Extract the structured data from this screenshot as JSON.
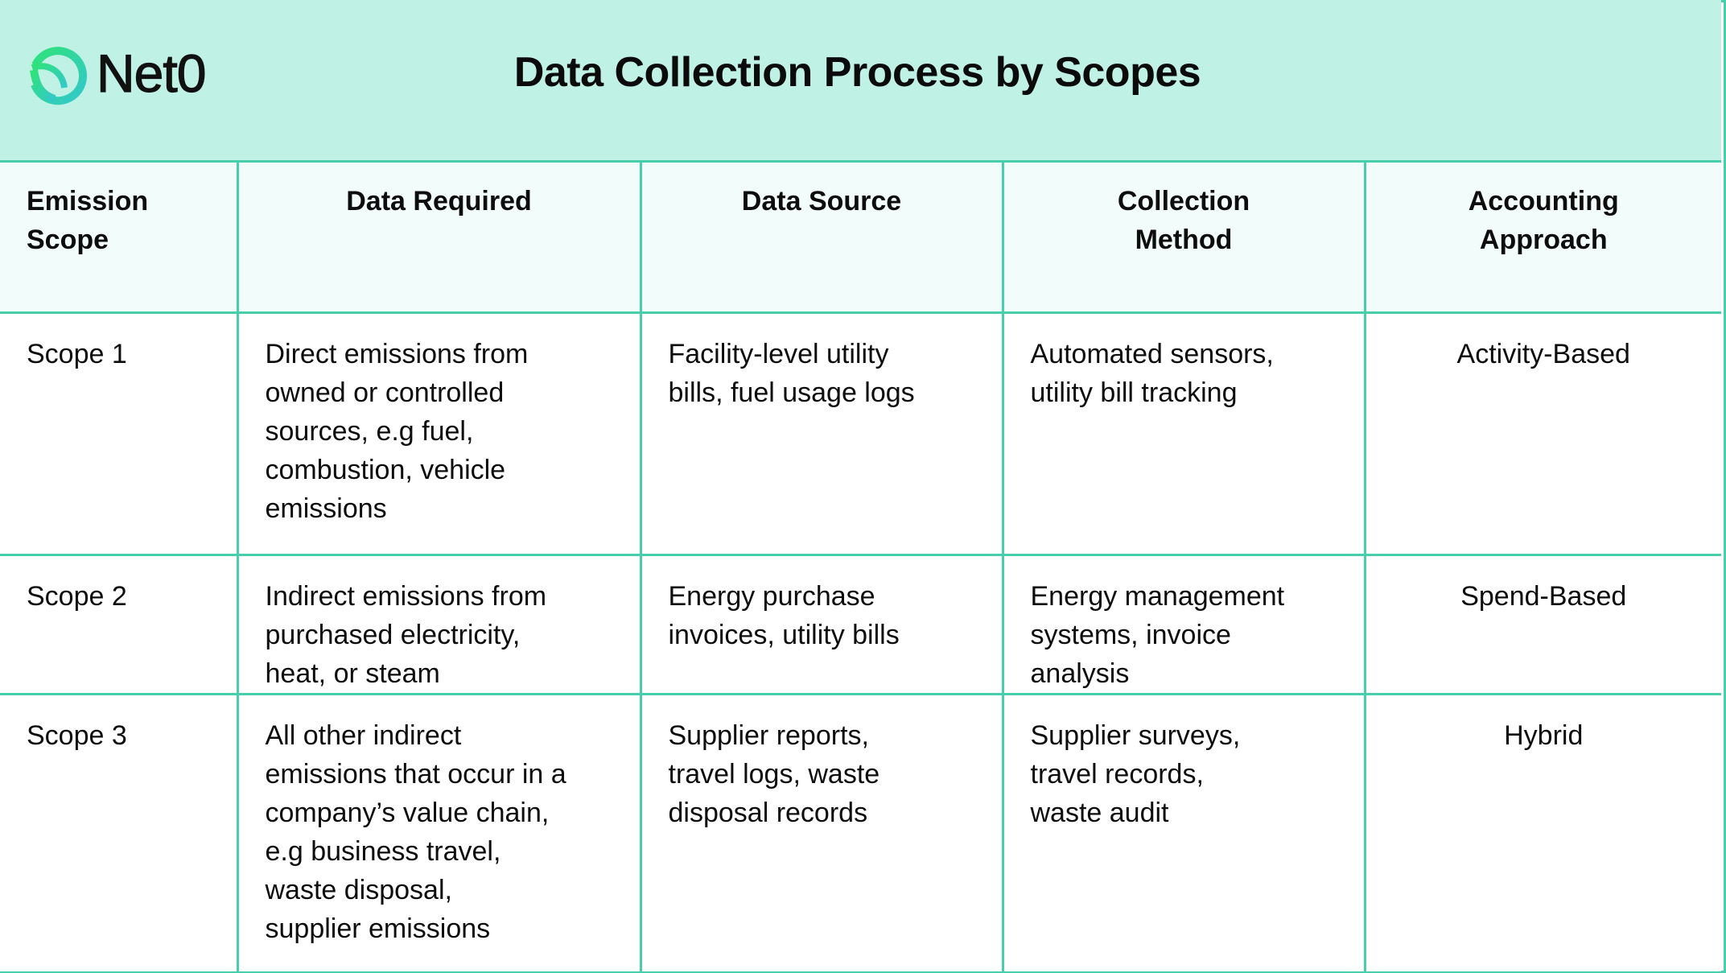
{
  "header": {
    "brand_name": "Net0",
    "logo_icon": "leaf-ring-icon",
    "title": "Data Collection Process by Scopes"
  },
  "colors": {
    "accent_border": "#47cfac",
    "banner_bg": "#c0f1e5",
    "header_row_bg": "#f2fcfa",
    "logo_gradient_start": "#2fe27a",
    "logo_gradient_end": "#33c8cc"
  },
  "table": {
    "columns": [
      "Emission\nScope",
      "Data Required",
      "Data Source",
      "Collection\nMethod",
      "Accounting\nApproach"
    ],
    "rows": [
      {
        "scope": "Scope 1",
        "data_required": "Direct emissions from\nowned or controlled\nsources, e.g fuel,\ncombustion, vehicle\nemissions",
        "data_source": "Facility-level utility\nbills, fuel usage logs",
        "collection_method": "Automated sensors,\nutility bill tracking",
        "accounting_approach": "Activity-Based"
      },
      {
        "scope": "Scope 2",
        "data_required": "Indirect emissions from\npurchased electricity,\nheat, or steam",
        "data_source": "Energy purchase\ninvoices, utility bills",
        "collection_method": "Energy management\nsystems, invoice\nanalysis",
        "accounting_approach": "Spend-Based"
      },
      {
        "scope": "Scope 3",
        "data_required": "All other indirect\nemissions that occur in a\ncompany’s value chain,\ne.g  business travel,\nwaste disposal,\nsupplier emissions",
        "data_source": "Supplier reports,\ntravel logs, waste\ndisposal records",
        "collection_method": "Supplier surveys,\ntravel records,\nwaste audit",
        "accounting_approach": "Hybrid"
      }
    ]
  }
}
